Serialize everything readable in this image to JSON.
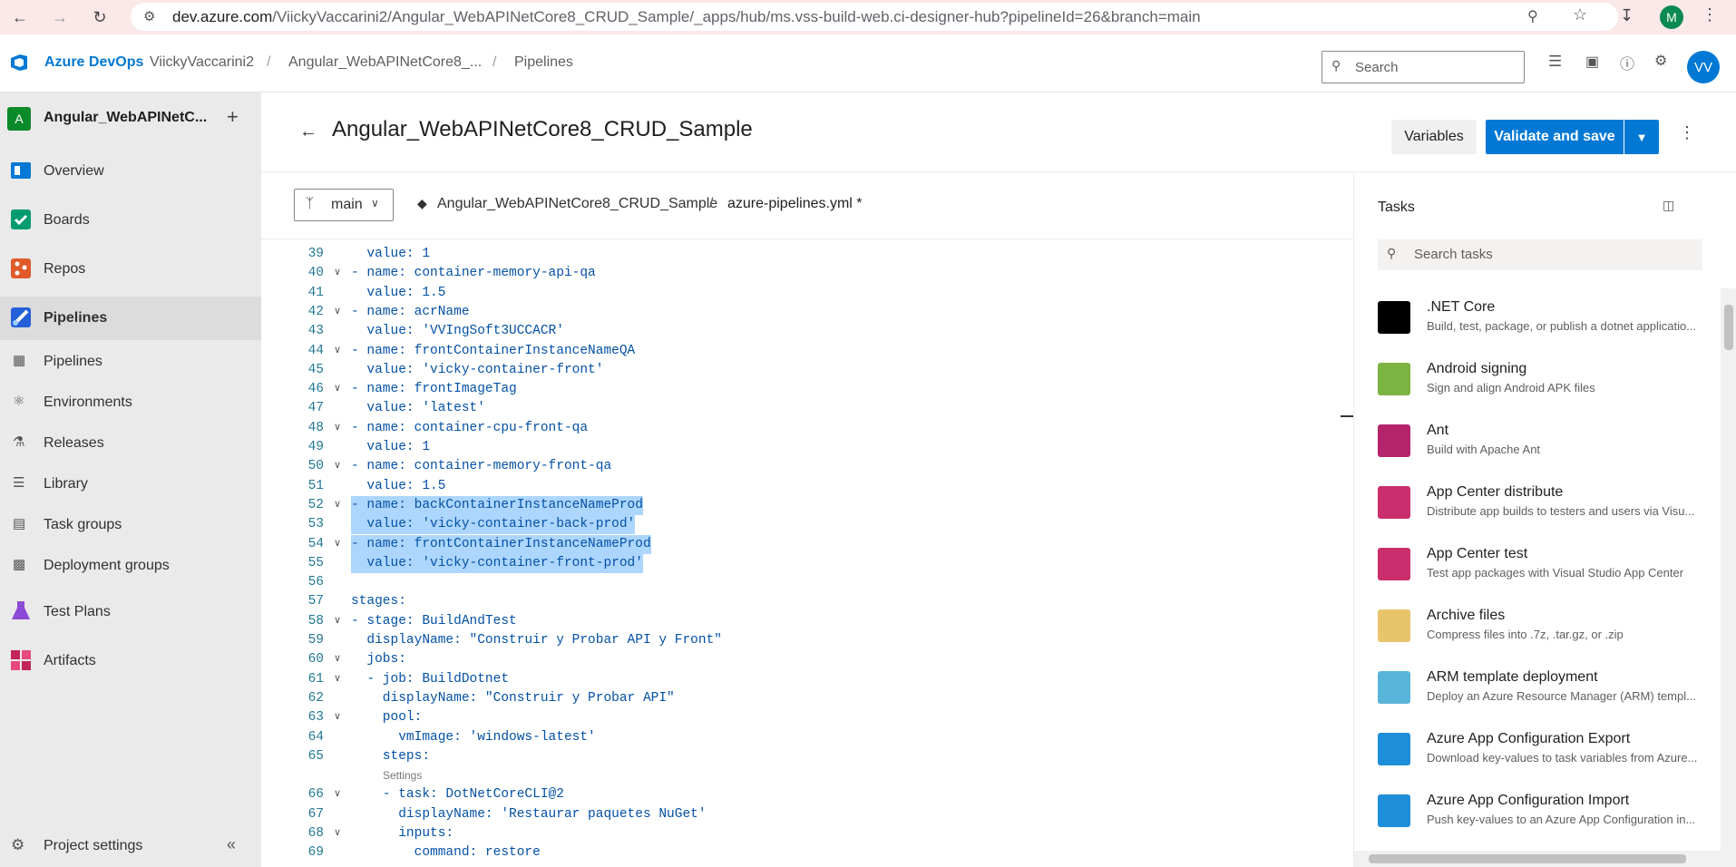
{
  "browser": {
    "url_host": "dev.azure.com",
    "url_path": "/ViickyVaccarini2/Angular_WebAPINetCore8_CRUD_Sample/_apps/hub/ms.vss-build-web.ci-designer-hub?pipelineId=26&branch=main",
    "profile_initial": "M"
  },
  "header": {
    "brand": "Azure DevOps",
    "org": "ViickyVaccarini2",
    "project": "Angular_WebAPINetCore8_...",
    "section": "Pipelines",
    "search_placeholder": "Search",
    "user_initials": "VV"
  },
  "sidebar": {
    "project_initial": "A",
    "project_name": "Angular_WebAPINetC...",
    "items": [
      {
        "label": "Overview"
      },
      {
        "label": "Boards"
      },
      {
        "label": "Repos"
      },
      {
        "label": "Pipelines"
      }
    ],
    "sub_items": [
      {
        "label": "Pipelines"
      },
      {
        "label": "Environments"
      },
      {
        "label": "Releases"
      },
      {
        "label": "Library"
      },
      {
        "label": "Task groups"
      },
      {
        "label": "Deployment groups"
      }
    ],
    "more_items": [
      {
        "label": "Test Plans"
      },
      {
        "label": "Artifacts"
      }
    ],
    "settings_label": "Project settings"
  },
  "page": {
    "title": "Angular_WebAPINetCore8_CRUD_Sample",
    "variables_label": "Variables",
    "save_label": "Validate and save",
    "branch": "main",
    "repo": "Angular_WebAPINetCore8_CRUD_Sample",
    "sep": "/",
    "file": "azure-pipelines.yml *"
  },
  "code": {
    "settings_lens": "Settings",
    "lines": [
      {
        "n": "39",
        "t": "  value: 1"
      },
      {
        "n": "40",
        "t": "- name: container-memory-api-qa"
      },
      {
        "n": "41",
        "t": "  value: 1.5"
      },
      {
        "n": "42",
        "t": "- name: acrName"
      },
      {
        "n": "43",
        "t": "  value: 'VVIngSoft3UCCACR'"
      },
      {
        "n": "44",
        "t": "- name: frontContainerInstanceNameQA"
      },
      {
        "n": "45",
        "t": "  value: 'vicky-container-front'"
      },
      {
        "n": "46",
        "t": "- name: frontImageTag"
      },
      {
        "n": "47",
        "t": "  value: 'latest'"
      },
      {
        "n": "48",
        "t": "- name: container-cpu-front-qa"
      },
      {
        "n": "49",
        "t": "  value: 1"
      },
      {
        "n": "50",
        "t": "- name: container-memory-front-qa"
      },
      {
        "n": "51",
        "t": "  value: 1.5"
      },
      {
        "n": "52",
        "t": "- name: backContainerInstanceNameProd"
      },
      {
        "n": "53",
        "t": "  value: 'vicky-container-back-prod'"
      },
      {
        "n": "54",
        "t": "- name: frontContainerInstanceNameProd"
      },
      {
        "n": "55",
        "t": "  value: 'vicky-container-front-prod'"
      },
      {
        "n": "56",
        "t": ""
      },
      {
        "n": "57",
        "t": "stages:"
      },
      {
        "n": "58",
        "t": "- stage: BuildAndTest"
      },
      {
        "n": "59",
        "t": "  displayName: \"Construir y Probar API y Front\""
      },
      {
        "n": "60",
        "t": "  jobs:"
      },
      {
        "n": "61",
        "t": "  - job: BuildDotnet"
      },
      {
        "n": "62",
        "t": "    displayName: \"Construir y Probar API\""
      },
      {
        "n": "63",
        "t": "    pool:"
      },
      {
        "n": "64",
        "t": "      vmImage: 'windows-latest'"
      },
      {
        "n": "65",
        "t": "    steps:"
      },
      {
        "n": "66",
        "t": "    - task: DotNetCoreCLI@2"
      },
      {
        "n": "67",
        "t": "      displayName: 'Restaurar paquetes NuGet'"
      },
      {
        "n": "68",
        "t": "      inputs:"
      },
      {
        "n": "69",
        "t": "        command: restore"
      }
    ]
  },
  "tasks": {
    "title": "Tasks",
    "search_placeholder": "Search tasks",
    "items": [
      {
        "name": ".NET Core",
        "desc": "Build, test, package, or publish a dotnet applicatio...",
        "icon": "dotnet-icon",
        "color": "#000000"
      },
      {
        "name": "Android signing",
        "desc": "Sign and align Android APK files",
        "icon": "android-icon",
        "color": "#7cb342"
      },
      {
        "name": "Ant",
        "desc": "Build with Apache Ant",
        "icon": "ant-icon",
        "color": "#b4246a"
      },
      {
        "name": "App Center distribute",
        "desc": "Distribute app builds to testers and users via Visu...",
        "icon": "appcenter-icon",
        "color": "#cb2e6d"
      },
      {
        "name": "App Center test",
        "desc": "Test app packages with Visual Studio App Center",
        "icon": "appcenter-icon",
        "color": "#cb2e6d"
      },
      {
        "name": "Archive files",
        "desc": "Compress files into .7z, .tar.gz, or .zip",
        "icon": "archive-icon",
        "color": "#e8c46a"
      },
      {
        "name": "ARM template deployment",
        "desc": "Deploy an Azure Resource Manager (ARM) templ...",
        "icon": "arm-icon",
        "color": "#59b4d9"
      },
      {
        "name": "Azure App Configuration Export",
        "desc": "Download key-values to task variables from Azure...",
        "icon": "appconfig-icon",
        "color": "#1e8ed8"
      },
      {
        "name": "Azure App Configuration Import",
        "desc": "Push key-values to an Azure App Configuration in...",
        "icon": "appconfig-icon",
        "color": "#1e8ed8"
      }
    ]
  }
}
